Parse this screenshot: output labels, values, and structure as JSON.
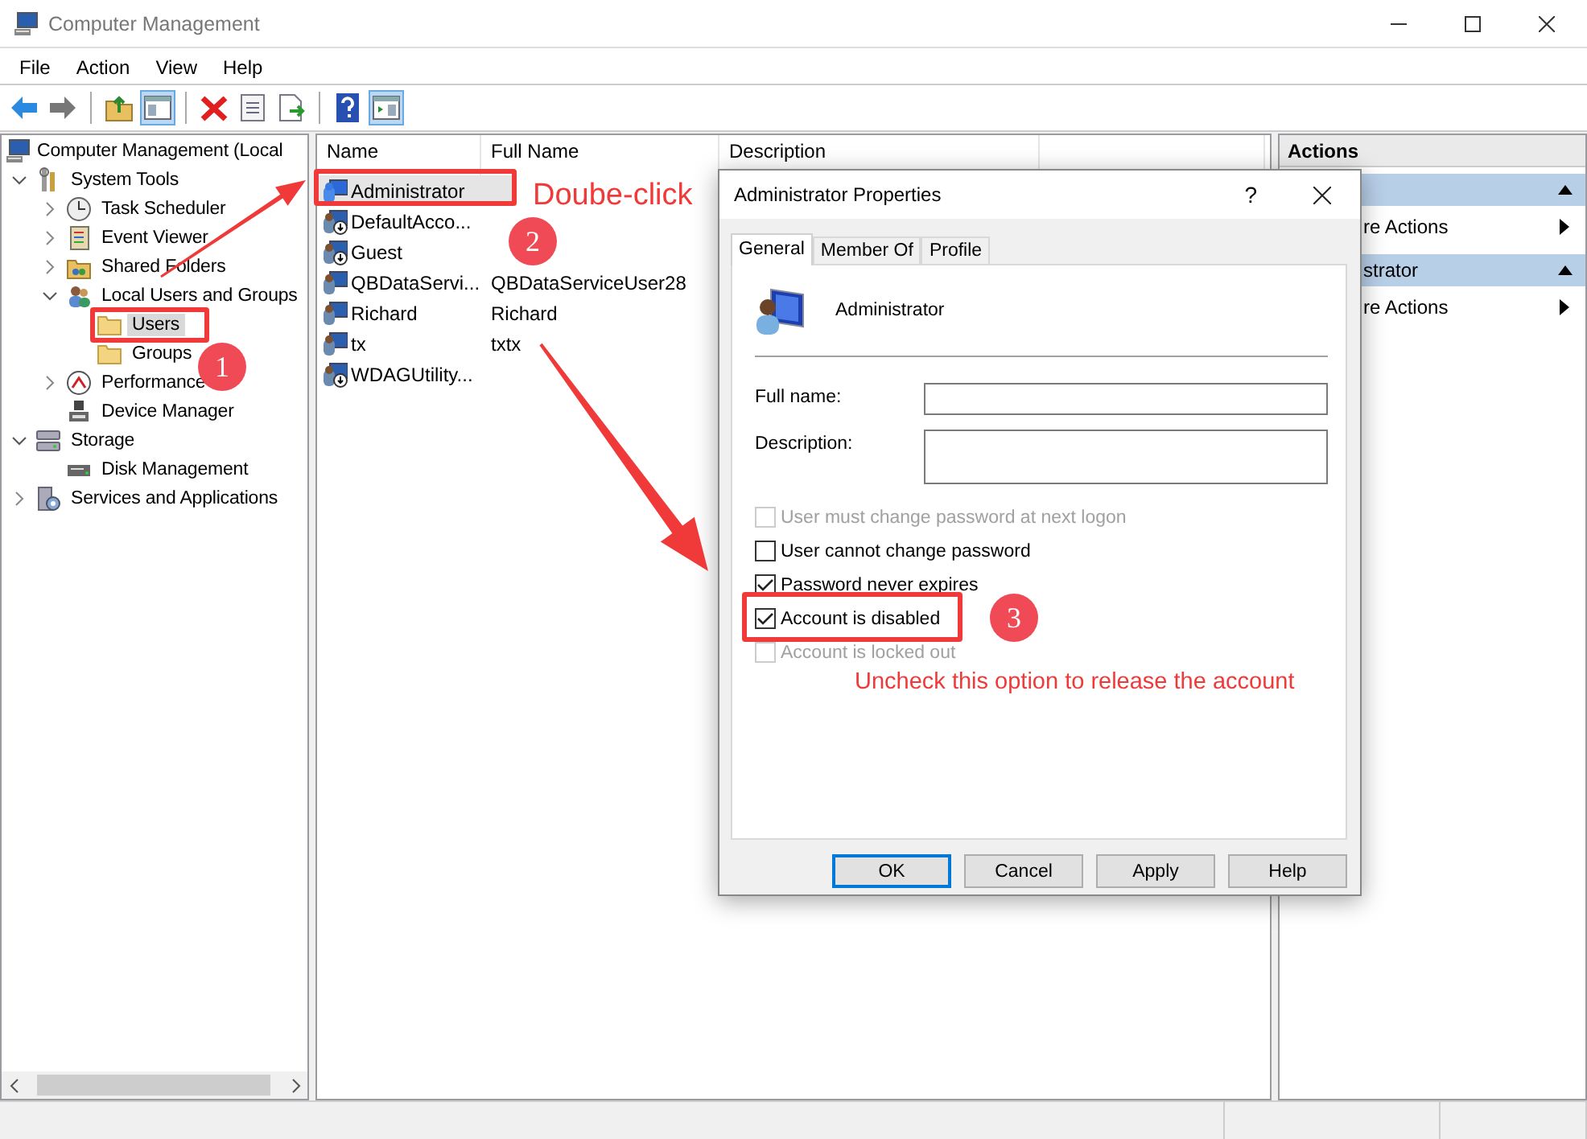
{
  "window": {
    "title": "Computer Management"
  },
  "menu": [
    {
      "label": "File"
    },
    {
      "label": "Action"
    },
    {
      "label": "View"
    },
    {
      "label": "Help"
    }
  ],
  "toolbar": [
    {
      "kind": "back",
      "pressed": false
    },
    {
      "kind": "forward",
      "pressed": false
    },
    {
      "kind": "sep"
    },
    {
      "kind": "up",
      "pressed": false
    },
    {
      "kind": "tree",
      "pressed": true
    },
    {
      "kind": "sep"
    },
    {
      "kind": "delete",
      "pressed": false
    },
    {
      "kind": "properties",
      "pressed": false
    },
    {
      "kind": "export",
      "pressed": false
    },
    {
      "kind": "sep"
    },
    {
      "kind": "help",
      "pressed": false
    },
    {
      "kind": "actionpane",
      "pressed": true
    }
  ],
  "tree": {
    "label": "Computer Management (Local",
    "kind": "computer",
    "selected": false,
    "children": [
      {
        "label": "System Tools",
        "kind": "tools",
        "expanded": true,
        "selected": false,
        "children": [
          {
            "label": "Task Scheduler",
            "kind": "clock",
            "expanded": false,
            "selected": false
          },
          {
            "label": "Event Viewer",
            "kind": "log",
            "expanded": false,
            "selected": false
          },
          {
            "label": "Shared Folders",
            "kind": "share",
            "expanded": false,
            "selected": false
          },
          {
            "label": "Local Users and Groups",
            "kind": "users",
            "expanded": true,
            "selected": false,
            "children": [
              {
                "label": "Users",
                "kind": "folder",
                "selected": true
              },
              {
                "label": "Groups",
                "kind": "folder",
                "selected": false
              }
            ]
          },
          {
            "label": "Performance",
            "kind": "gauge",
            "expanded": false,
            "selected": false
          },
          {
            "label": "Device Manager",
            "kind": "device",
            "selected": false
          }
        ]
      },
      {
        "label": "Storage",
        "kind": "storage",
        "expanded": true,
        "selected": false,
        "children": [
          {
            "label": "Disk Management",
            "kind": "disk",
            "selected": false
          }
        ]
      },
      {
        "label": "Services and Applications",
        "kind": "services",
        "expanded": false,
        "selected": false
      }
    ]
  },
  "table": {
    "columns": [
      "Name",
      "Full Name",
      "Description"
    ],
    "rows": [
      {
        "name": "Administrator",
        "selected": true,
        "disabled": false
      },
      {
        "name": "DefaultAcco...",
        "selected": false,
        "disabled": true
      },
      {
        "name": "Guest",
        "selected": false,
        "disabled": true
      },
      {
        "name": "QBDataServi...",
        "full_name": "QBDataServiceUser28",
        "selected": false,
        "disabled": false
      },
      {
        "name": "Richard",
        "full_name": "Richard",
        "selected": false,
        "disabled": false
      },
      {
        "name": "tx",
        "full_name": "txtx",
        "selected": false,
        "disabled": false
      },
      {
        "name": "WDAGUtility...",
        "selected": false,
        "disabled": true
      }
    ]
  },
  "actions": {
    "title": "Actions",
    "sections": [
      {
        "expanded": true,
        "items": [
          {
            "label": "re Actions"
          }
        ]
      },
      {
        "title": "strator",
        "expanded": true,
        "items": [
          {
            "label": "re Actions"
          }
        ]
      }
    ]
  },
  "dialog": {
    "title": "Administrator Properties",
    "help": "?",
    "tabs": [
      {
        "label": "General",
        "selected": true
      },
      {
        "label": "Member Of",
        "selected": false
      },
      {
        "label": "Profile",
        "selected": false
      }
    ],
    "user_name": "Administrator",
    "fields": [
      {
        "label": "Full name:",
        "kind": "line"
      },
      {
        "label": "Description:",
        "kind": "area"
      }
    ],
    "options": [
      {
        "label": "User must change password at next logon",
        "checked": false,
        "disabled": true
      },
      {
        "label": "User cannot change password",
        "checked": false,
        "disabled": false
      },
      {
        "label": "Password never expires",
        "checked": true,
        "disabled": false
      },
      {
        "label": "Account is disabled",
        "checked": true,
        "disabled": false
      },
      {
        "label": "Account is locked out",
        "checked": false,
        "disabled": true
      }
    ],
    "buttons": [
      {
        "label": "OK",
        "default": true
      },
      {
        "label": "Cancel",
        "default": false
      },
      {
        "label": "Apply",
        "default": false
      },
      {
        "label": "Help",
        "default": false
      }
    ]
  },
  "annotations": {
    "steps": [
      "1",
      "2",
      "3"
    ],
    "notes": [
      "Doube-click",
      "Uncheck this option to release the account"
    ]
  }
}
